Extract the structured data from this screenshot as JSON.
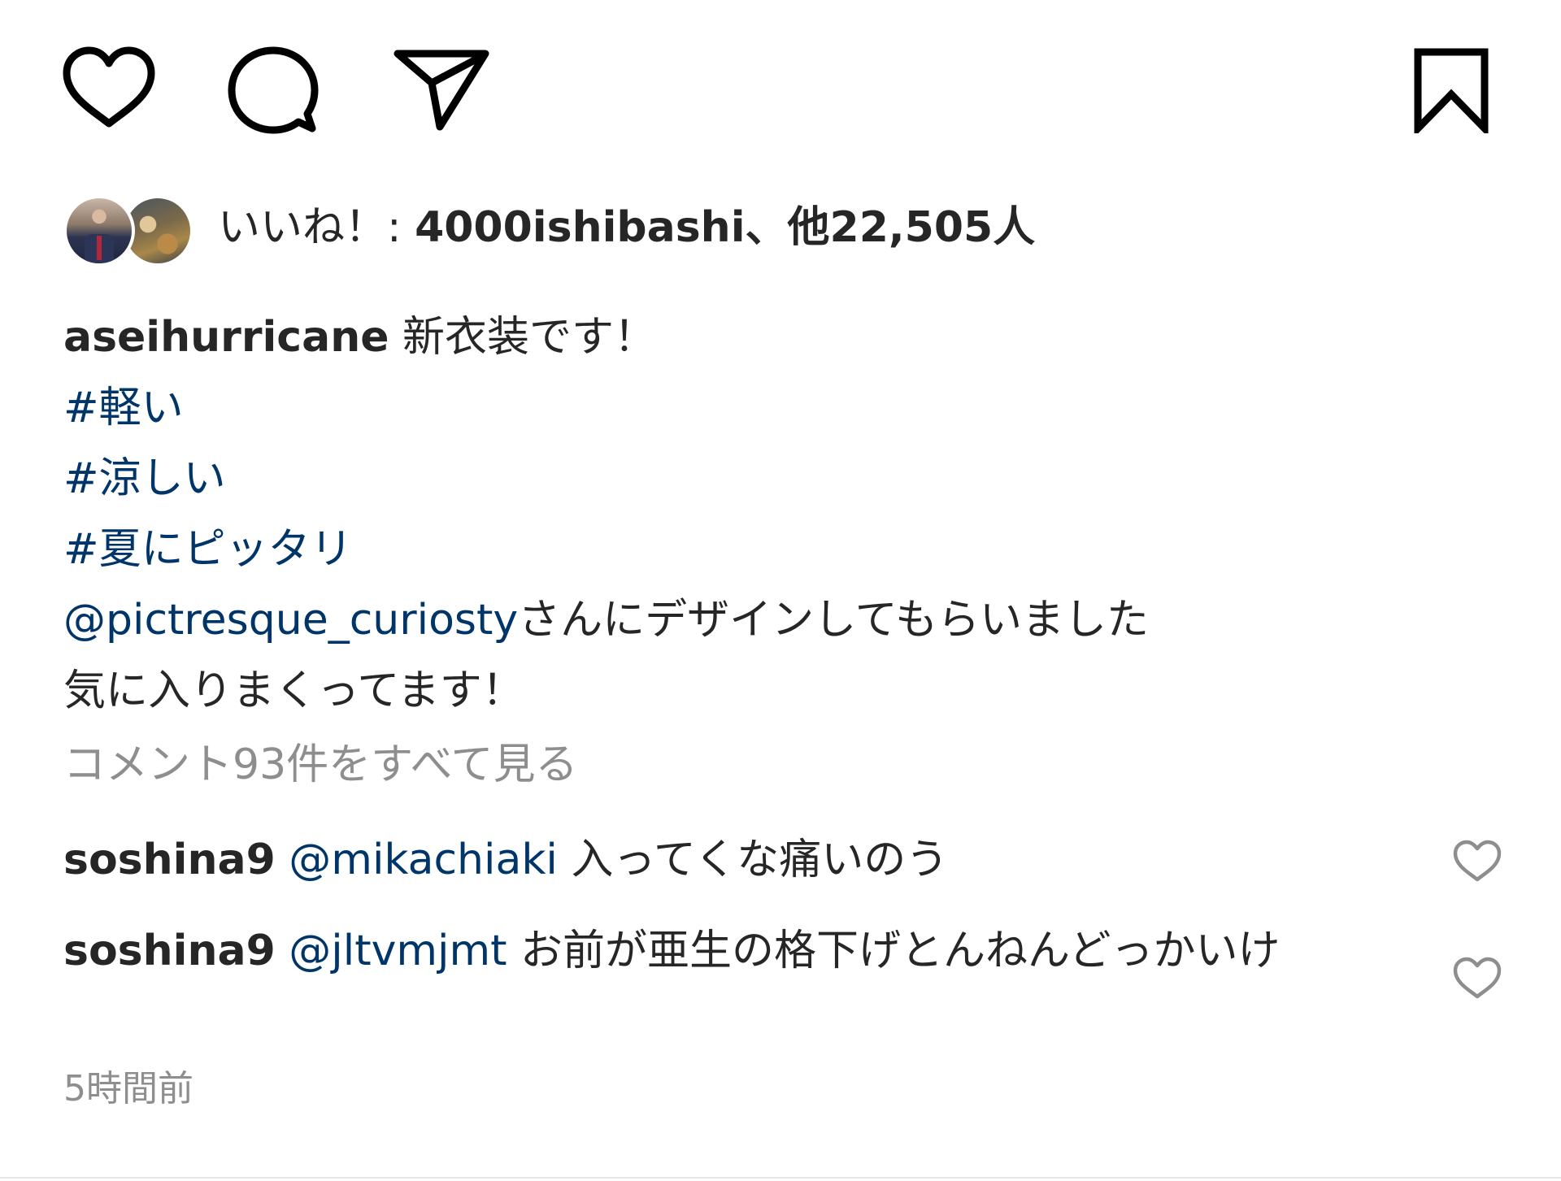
{
  "colors": {
    "text": "#262626",
    "link": "#003569",
    "muted": "#8e8e8e",
    "background": "#ffffff"
  },
  "actions": {
    "like_icon": "heart-outline-icon",
    "comment_icon": "speech-bubble-icon",
    "share_icon": "paper-plane-icon",
    "save_icon": "bookmark-icon"
  },
  "likes": {
    "prefix": "いいね！: ",
    "first_liker": "4000ishibashi",
    "separator": "、",
    "others": "他22,505人"
  },
  "caption": {
    "username": "aseihurricane",
    "text": " 新衣装です！",
    "hashtags": [
      "#軽い",
      "#涼しい",
      "#夏にピッタリ"
    ],
    "mention": "@pictresque_curiosty",
    "mention_suffix": "さんにデザインしてもらいました",
    "last_line": "気に入りまくってます！"
  },
  "view_all_comments": "コメント93件をすべて見る",
  "comments": [
    {
      "username": "soshina9",
      "mention": "@mikachiaki",
      "text": " 入ってくな痛いのう"
    },
    {
      "username": "soshina9",
      "mention": "@jltvmjmt",
      "text": " お前が亜生の格下げとんねんどっかいけ"
    }
  ],
  "timestamp": "5時間前"
}
